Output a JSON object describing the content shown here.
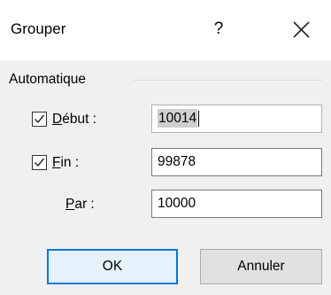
{
  "dialog": {
    "title": "Grouper",
    "help_glyph": "?",
    "close_icon": "close-icon"
  },
  "group": {
    "label": "Automatique"
  },
  "fields": {
    "start": {
      "checked": true,
      "label_mnemonic": "D",
      "label_rest": "ébut :",
      "value": "10014"
    },
    "end": {
      "checked": true,
      "label_mnemonic": "F",
      "label_rest": "in :",
      "value": "99878"
    },
    "by": {
      "label_mnemonic": "P",
      "label_rest": "ar :",
      "value": "10000"
    }
  },
  "buttons": {
    "ok": "OK",
    "cancel": "Annuler"
  },
  "colors": {
    "dialog_bg": "#f0f0f0",
    "accent_border": "#0078d7",
    "ok_fill": "#e5f1fb"
  }
}
